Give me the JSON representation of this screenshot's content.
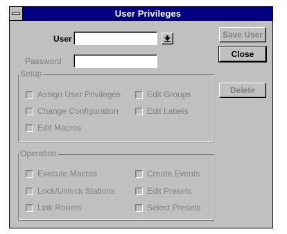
{
  "window": {
    "title": "User Privileges"
  },
  "fields": {
    "user_label": "User",
    "user_value": "",
    "password_label": "Password",
    "password_value": ""
  },
  "buttons": {
    "save_user": "Save User",
    "close": "Close",
    "delete": "Delete"
  },
  "setup": {
    "legend": "Setup",
    "items": [
      {
        "label": "Assign User Privileges"
      },
      {
        "label": "Edit Groups"
      },
      {
        "label": "Change Configuration"
      },
      {
        "label": "Edit Labels"
      },
      {
        "label": "Edit Macros"
      }
    ]
  },
  "operation": {
    "legend": "Operation",
    "items": [
      {
        "label": "Execute Macros"
      },
      {
        "label": "Create Events"
      },
      {
        "label": "Lock/Unlock Stations"
      },
      {
        "label": "Edit Presets"
      },
      {
        "label": "Link Rooms"
      },
      {
        "label": "Select Presets"
      }
    ]
  },
  "icons": {
    "system_menu": "system-menu-icon",
    "dropdown_arrow": "chevron-down-icon",
    "checkbox": "checkbox-icon"
  },
  "colors": {
    "title_bar": "#000080",
    "face": "#c0c0c0",
    "disabled_text": "#808080"
  }
}
